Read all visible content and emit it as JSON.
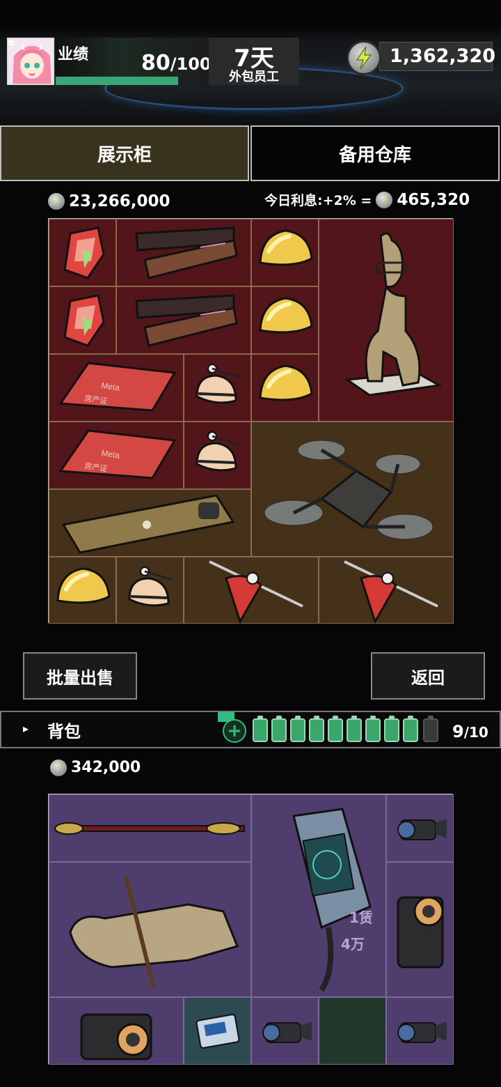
{
  "header": {
    "performance_label": "业绩",
    "performance_value": "80",
    "performance_max": "/100",
    "performance_progress": 0.8,
    "days_value": "7天",
    "days_subtitle": "外包员工",
    "balance": "1,362,320"
  },
  "tabs": [
    {
      "label": "展示柜",
      "active": true
    },
    {
      "label": "备用仓库",
      "active": false
    }
  ],
  "showcase": {
    "total_value": "23,266,000",
    "interest_label": "今日利息:+2% =",
    "interest_value": "465,320",
    "items": [
      "red-gem",
      "chopsticks-box",
      "gold-nugget",
      "clay-statue",
      "property-certificate",
      "robot-head",
      "phone",
      "drone",
      "spinning-top"
    ],
    "cert_text": "Meta",
    "cert_sub": "房产证"
  },
  "buttons": {
    "bulk_sell": "批量出售",
    "back": "返回"
  },
  "backpack": {
    "label": "背包",
    "capacity_used": "9",
    "capacity_max": "/10",
    "batteries_full": 9,
    "batteries_total": 10,
    "total_value": "342,000",
    "overlay_text_1": "1赁",
    "overlay_text_2": "4万"
  },
  "colors": {
    "accent_green": "#3aa577",
    "tab_active": "#38331d",
    "showcase_red": "#52161a",
    "showcase_brown": "#45301a",
    "backpack_purple": "#4f3d6d"
  }
}
